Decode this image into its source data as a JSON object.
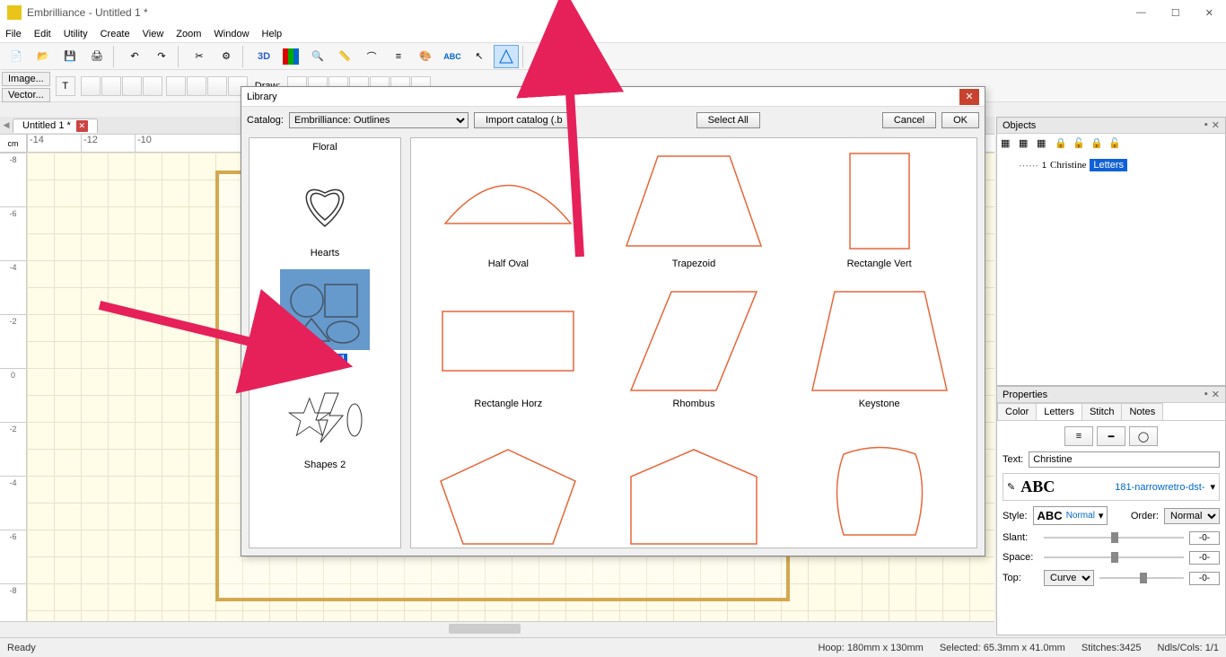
{
  "app": {
    "title": "Embrilliance  -  Untitled 1 *"
  },
  "menu": [
    "File",
    "Edit",
    "Utility",
    "Create",
    "View",
    "Zoom",
    "Window",
    "Help"
  ],
  "leftButtons": {
    "image": "Image...",
    "vector": "Vector..."
  },
  "toolbar2": {
    "drawLabel": "Draw:"
  },
  "docTab": {
    "name": "Untitled 1 *"
  },
  "ruler": {
    "unit": "cm",
    "h": [
      "-14",
      "-12",
      "-10"
    ],
    "v": [
      "-8",
      "-6",
      "-4",
      "-2",
      "0",
      "-2",
      "-4",
      "-6",
      "-8"
    ]
  },
  "objectsPanel": {
    "title": "Objects",
    "item1": {
      "index": "1",
      "name": "Christine",
      "type": "Letters"
    }
  },
  "propertiesPanel": {
    "title": "Properties",
    "tabs": {
      "color": "Color",
      "letters": "Letters",
      "stitch": "Stitch",
      "notes": "Notes"
    },
    "textLabel": "Text:",
    "textValue": "Christine",
    "fontName": "181-narrowretro-dst-",
    "styleLabel": "Style:",
    "styleBtn": "ABC",
    "styleMode": "Normal",
    "orderLabel": "Order:",
    "orderValue": "Normal",
    "slantLabel": "Slant:",
    "slantValue": "-0-",
    "spaceLabel": "Space:",
    "spaceValue": "-0-",
    "topLabel": "Top:",
    "topSelect": "Curve",
    "topValue": "-0-"
  },
  "status": {
    "ready": "Ready",
    "hoop": "Hoop: 180mm x 130mm",
    "selected": "Selected: 65.3mm x 41.0mm",
    "stitches": "Stitches:3425",
    "ndls": "Ndls/Cols: 1/1"
  },
  "dialog": {
    "title": "Library",
    "catalogLabel": "Catalog:",
    "catalogValue": "Embrilliance: Outlines",
    "importBtn": "Import catalog (.b",
    "selectAll": "Select All",
    "cancel": "Cancel",
    "ok": "OK",
    "categories": [
      {
        "name": "Floral"
      },
      {
        "name": "Hearts"
      },
      {
        "name": "Shapes 1",
        "selected": true
      },
      {
        "name": "Shapes 2"
      }
    ],
    "shapes": [
      {
        "name": "Half Oval"
      },
      {
        "name": "Trapezoid"
      },
      {
        "name": "Rectangle Vert"
      },
      {
        "name": "Rectangle Horz"
      },
      {
        "name": "Rhombus"
      },
      {
        "name": "Keystone"
      },
      {
        "name": ""
      },
      {
        "name": ""
      },
      {
        "name": ""
      }
    ]
  }
}
